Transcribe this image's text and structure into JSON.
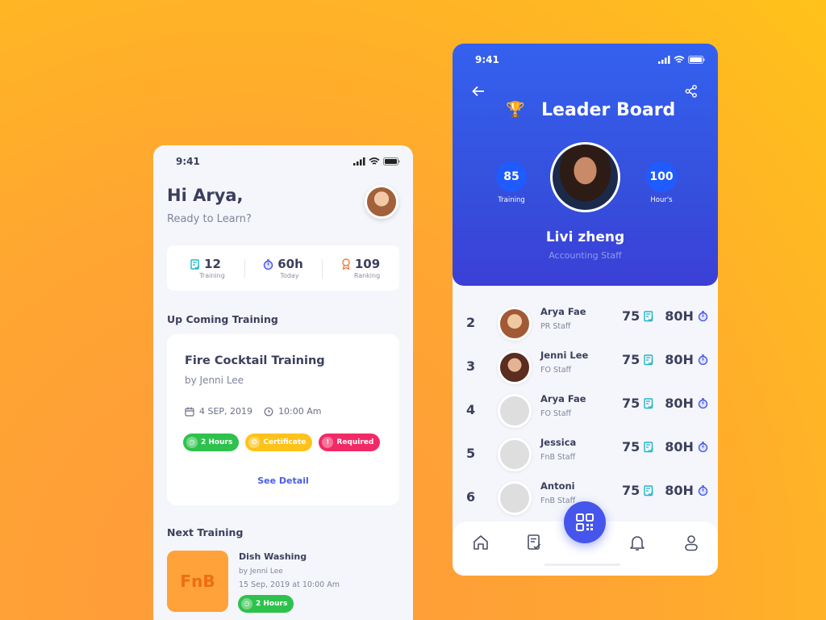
{
  "colors": {
    "accent": "#4656ec",
    "green": "#2ec24c",
    "yellow": "#ffc21a",
    "red": "#f12a65",
    "header": "#3461ee"
  },
  "left": {
    "status": {
      "time": "9:41"
    },
    "greeting": "Hi Arya,",
    "subtitle": "Ready to Learn?",
    "stats": [
      {
        "value": "12",
        "label": "Training",
        "icon": "doc-check-icon"
      },
      {
        "value": "60h",
        "label": "Today",
        "icon": "stopwatch-icon"
      },
      {
        "value": "109",
        "label": "Ranking",
        "icon": "ribbon-icon"
      }
    ],
    "upcoming_heading": "Up Coming Training",
    "upcoming": {
      "title": "Fire Cocktail Training",
      "by": "by Jenni Lee",
      "date": "4 SEP, 2019",
      "time": "10:00 Am",
      "tags": [
        {
          "label": "2 Hours",
          "color": "#2ec24c"
        },
        {
          "label": "Certificate",
          "color": "#ffc21a"
        },
        {
          "label": "Required",
          "color": "#f12a65"
        }
      ],
      "cta": "See Detail"
    },
    "next_heading": "Next Training",
    "next": {
      "thumb": "FnB",
      "title": "Dish Washing",
      "by": "by Jenni Lee",
      "datetime": "15 Sep, 2019 at 10:00 Am",
      "tag": "2 Hours"
    }
  },
  "right": {
    "status": {
      "time": "9:41"
    },
    "title": "Leader Board",
    "leader": {
      "name": "Livi zheng",
      "role": "Accounting Staff",
      "training": "85",
      "training_label": "Training",
      "hours": "100",
      "hours_label": "Hour's"
    },
    "rows": [
      {
        "rank": "2",
        "name": "Arya Fae",
        "role": "PR Staff",
        "score": "75",
        "hours": "80H"
      },
      {
        "rank": "3",
        "name": "Jenni Lee",
        "role": "FO Staff",
        "score": "75",
        "hours": "80H"
      },
      {
        "rank": "4",
        "name": "Arya Fae",
        "role": "FO Staff",
        "score": "75",
        "hours": "80H"
      },
      {
        "rank": "5",
        "name": "Jessica",
        "role": "FnB Staff",
        "score": "75",
        "hours": "80H"
      },
      {
        "rank": "6",
        "name": "Antoni",
        "role": "FnB Staff",
        "score": "75",
        "hours": "80H"
      }
    ],
    "nav": [
      "home-icon",
      "list-check-icon",
      "qr-code-icon",
      "bell-icon",
      "user-icon"
    ]
  }
}
